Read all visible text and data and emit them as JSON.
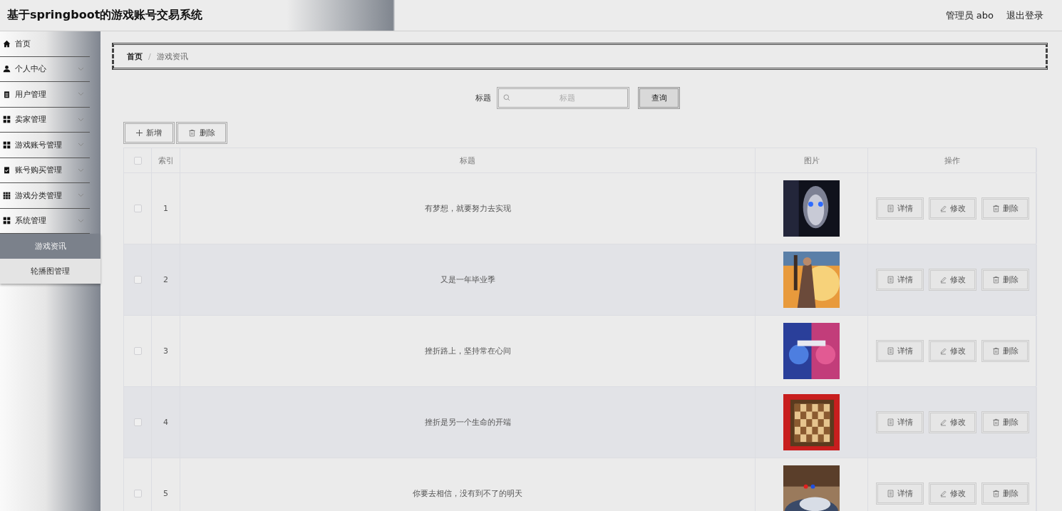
{
  "header": {
    "title": "基于springboot的游戏账号交易系统",
    "user": "管理员 abo",
    "logout": "退出登录"
  },
  "sidebar": {
    "items": [
      {
        "kind": "link",
        "label": "首页",
        "selected": false
      },
      {
        "kind": "menu",
        "label": "个人中心",
        "selected": false
      },
      {
        "kind": "menu",
        "label": "用户管理",
        "selected": false
      },
      {
        "kind": "menu",
        "label": "卖家管理",
        "selected": false
      },
      {
        "kind": "menu",
        "label": "游戏账号管理",
        "selected": false
      },
      {
        "kind": "menu",
        "label": "账号购买管理",
        "selected": false
      },
      {
        "kind": "menu",
        "label": "游戏分类管理",
        "selected": false
      },
      {
        "kind": "menu",
        "label": "系统管理",
        "selected": false,
        "children": [
          {
            "label": "游戏资讯",
            "selected": true
          },
          {
            "label": "轮播图管理",
            "selected": false
          }
        ]
      }
    ]
  },
  "breadcrumb": {
    "items": [
      "首页",
      "游戏资讯"
    ],
    "separator": "/"
  },
  "search": {
    "label": "标题",
    "placeholder": "标题",
    "button": "查询"
  },
  "toolbar": {
    "add": "新增",
    "delete": "删除"
  },
  "table": {
    "header_checked": false,
    "columns": [
      "索引",
      "标题",
      "图片",
      "操作"
    ],
    "rows": [
      {
        "checked": false,
        "index": "1",
        "title": "有梦想，就要努力去实现",
        "image": {
          "kind": "picture"
        },
        "actions": [
          "详情",
          "修改",
          "删除"
        ]
      },
      {
        "checked": false,
        "index": "2",
        "title": "又是一年毕业季",
        "image": {
          "kind": "picture"
        },
        "actions": [
          "详情",
          "修改",
          "删除"
        ]
      },
      {
        "checked": false,
        "index": "3",
        "title": "挫折路上，坚持常在心间",
        "image": {
          "kind": "picture"
        },
        "actions": [
          "详情",
          "修改",
          "删除"
        ]
      },
      {
        "checked": false,
        "index": "4",
        "title": "挫折是另一个生命的开端",
        "image": {
          "kind": "picture"
        },
        "actions": [
          "详情",
          "修改",
          "删除"
        ]
      },
      {
        "checked": false,
        "index": "5",
        "title": "你要去相信，没有到不了的明天",
        "image": {
          "kind": "picture"
        },
        "actions": [
          "详情",
          "修改",
          "删除"
        ]
      }
    ]
  }
}
